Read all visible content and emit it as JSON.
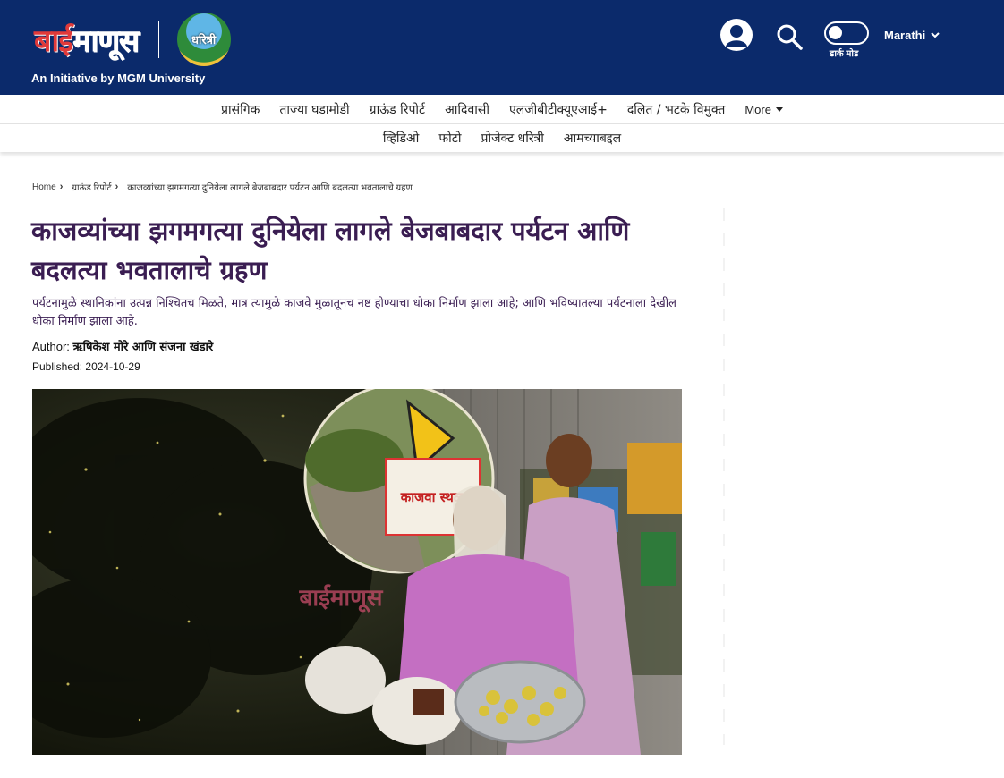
{
  "header": {
    "logo_part1": "बाई",
    "logo_part2": "माणूस",
    "partner_logo_text": "धरित्री",
    "tagline": "An Initiative by MGM University",
    "theme_toggle_label": "डार्क मोड",
    "language": "Marathi",
    "icons": [
      "user-icon",
      "search-icon",
      "theme-toggle",
      "chevron-down-icon"
    ],
    "colors": {
      "bar_bg": "#0b2a6b",
      "logo_accent": "#e03a3a"
    }
  },
  "nav": {
    "primary": [
      "प्रासंगिक",
      "ताज्या घडामोडी",
      "ग्राऊंड रिपोर्ट",
      "आदिवासी",
      "एलजीबीटीक्यूएआई+",
      "दलित / भटके विमुक्त"
    ],
    "more_label": "More",
    "secondary": [
      "व्हिडिओ",
      "फोटो",
      "प्रोजेक्ट धरित्री",
      "आमच्याबद्दल"
    ]
  },
  "breadcrumb": {
    "home": "Home",
    "category": "ग्राऊंड रिपोर्ट",
    "current": "काजव्यांच्या झगमगत्या दुनियेला लागले बेजबाबदार पर्यटन आणि बदलत्या भवतालाचे ग्रहण"
  },
  "article": {
    "title": "काजव्यांच्या झगमगत्या दुनियेला लागले बेजबाबदार पर्यटन आणि बदलत्या भवतालाचे ग्रहण",
    "subtitle": "पर्यटनामुळे स्थानिकांना उत्पन्न निश्चितच मिळते, मात्र त्यामुळे काजवे मुळातूनच नष्ट होण्याचा धोका निर्माण झाला आहे; आणि भविष्यातल्या पर्यटनाला देखील धोका निर्माण झाला आहे.",
    "author_label": "Author:",
    "author": "ऋषिकेश मोरे आणि संजना खंडारे",
    "published_label": "Published:",
    "published": "2024-10-29",
    "hero": {
      "sign_text": "काजवा स्थळ",
      "watermark": "बाईमाणूस"
    }
  }
}
